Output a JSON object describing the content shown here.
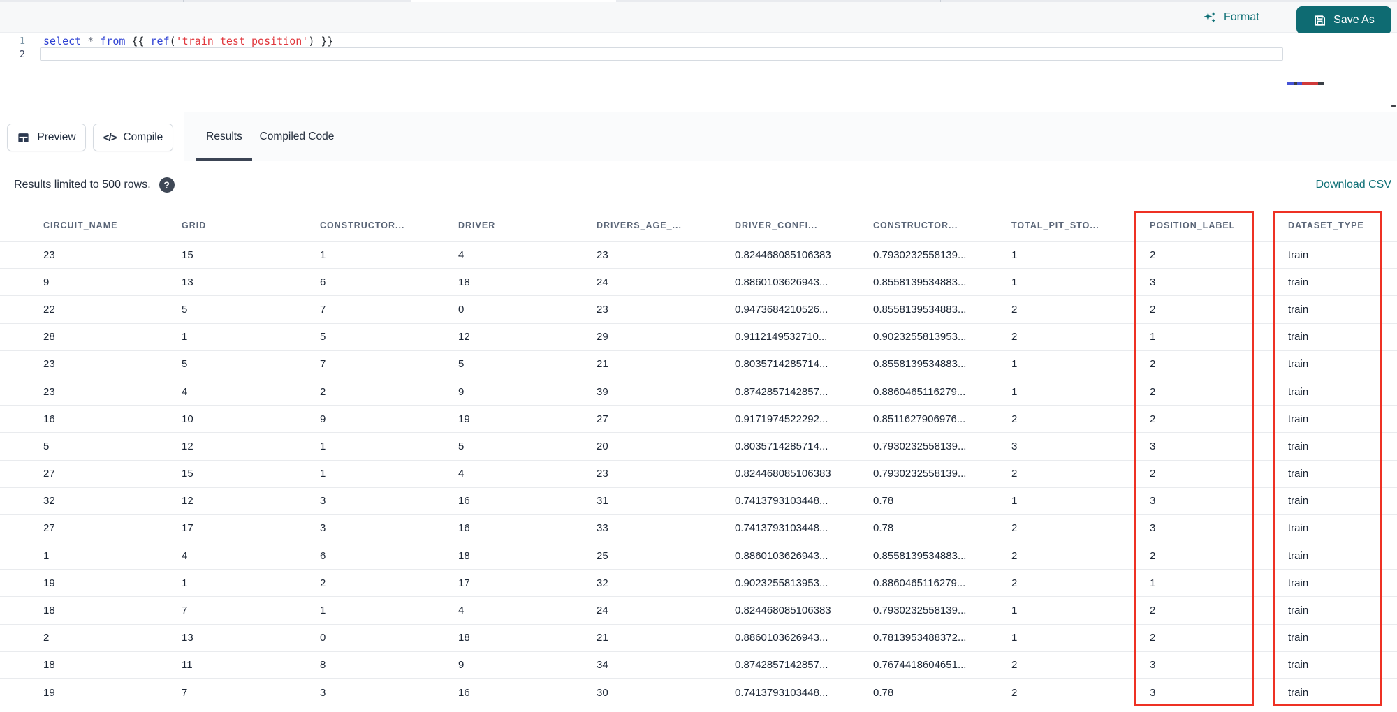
{
  "colors": {
    "accent_teal": "#0f7076",
    "save_button_bg": "#0e6b72",
    "highlight_red": "#ee3124",
    "header_text": "#5a6577",
    "cell_text": "#1c2635"
  },
  "toolbar": {
    "format_label": "Format",
    "save_as_label": "Save As"
  },
  "editor": {
    "line_numbers": [
      "1",
      "2"
    ],
    "code_tokens": [
      {
        "text": "select",
        "color": "#2e41d3"
      },
      {
        "text": " ",
        "color": ""
      },
      {
        "text": "*",
        "color": "#6b7280"
      },
      {
        "text": " ",
        "color": ""
      },
      {
        "text": "from",
        "color": "#2e41d3"
      },
      {
        "text": " {{ ",
        "color": "#24292f"
      },
      {
        "text": "ref",
        "color": "#2e41d3"
      },
      {
        "text": "(",
        "color": "#24292f"
      },
      {
        "text": "'train_test_position'",
        "color": "#e0383e"
      },
      {
        "text": ")",
        "color": "#24292f"
      },
      {
        "text": " }}",
        "color": "#24292f"
      }
    ]
  },
  "action_bar": {
    "preview_label": "Preview",
    "compile_label": "Compile",
    "compile_glyph": "</>",
    "tabs": [
      {
        "label": "Results",
        "active": true
      },
      {
        "label": "Compiled Code",
        "active": false
      }
    ]
  },
  "results_bar": {
    "limit_text": "Results limited to 500 rows.",
    "help_glyph": "?",
    "download_label": "Download CSV"
  },
  "table": {
    "columns": [
      "CIRCUIT_NAME",
      "GRID",
      "CONSTRUCTOR...",
      "DRIVER",
      "DRIVERS_AGE_...",
      "DRIVER_CONFI...",
      "CONSTRUCTOR...",
      "TOTAL_PIT_STO...",
      "POSITION_LABEL",
      "DATASET_TYPE"
    ],
    "highlighted_columns": [
      "POSITION_LABEL",
      "DATASET_TYPE"
    ],
    "rows": [
      [
        "23",
        "15",
        "1",
        "4",
        "23",
        "0.824468085106383",
        "0.7930232558139...",
        "1",
        "2",
        "train"
      ],
      [
        "9",
        "13",
        "6",
        "18",
        "24",
        "0.8860103626943...",
        "0.8558139534883...",
        "1",
        "3",
        "train"
      ],
      [
        "22",
        "5",
        "7",
        "0",
        "23",
        "0.9473684210526...",
        "0.8558139534883...",
        "2",
        "2",
        "train"
      ],
      [
        "28",
        "1",
        "5",
        "12",
        "29",
        "0.9112149532710...",
        "0.9023255813953...",
        "2",
        "1",
        "train"
      ],
      [
        "23",
        "5",
        "7",
        "5",
        "21",
        "0.8035714285714...",
        "0.8558139534883...",
        "1",
        "2",
        "train"
      ],
      [
        "23",
        "4",
        "2",
        "9",
        "39",
        "0.8742857142857...",
        "0.8860465116279...",
        "1",
        "2",
        "train"
      ],
      [
        "16",
        "10",
        "9",
        "19",
        "27",
        "0.9171974522292...",
        "0.8511627906976...",
        "2",
        "2",
        "train"
      ],
      [
        "5",
        "12",
        "1",
        "5",
        "20",
        "0.8035714285714...",
        "0.7930232558139...",
        "3",
        "3",
        "train"
      ],
      [
        "27",
        "15",
        "1",
        "4",
        "23",
        "0.824468085106383",
        "0.7930232558139...",
        "2",
        "2",
        "train"
      ],
      [
        "32",
        "12",
        "3",
        "16",
        "31",
        "0.7413793103448...",
        "0.78",
        "1",
        "3",
        "train"
      ],
      [
        "27",
        "17",
        "3",
        "16",
        "33",
        "0.7413793103448...",
        "0.78",
        "2",
        "3",
        "train"
      ],
      [
        "1",
        "4",
        "6",
        "18",
        "25",
        "0.8860103626943...",
        "0.8558139534883...",
        "2",
        "2",
        "train"
      ],
      [
        "19",
        "1",
        "2",
        "17",
        "32",
        "0.9023255813953...",
        "0.8860465116279...",
        "2",
        "1",
        "train"
      ],
      [
        "18",
        "7",
        "1",
        "4",
        "24",
        "0.824468085106383",
        "0.7930232558139...",
        "1",
        "2",
        "train"
      ],
      [
        "2",
        "13",
        "0",
        "18",
        "21",
        "0.8860103626943...",
        "0.7813953488372...",
        "1",
        "2",
        "train"
      ],
      [
        "18",
        "11",
        "8",
        "9",
        "34",
        "0.8742857142857...",
        "0.7674418604651...",
        "2",
        "3",
        "train"
      ],
      [
        "19",
        "7",
        "3",
        "16",
        "30",
        "0.7413793103448...",
        "0.78",
        "2",
        "3",
        "train"
      ]
    ]
  }
}
